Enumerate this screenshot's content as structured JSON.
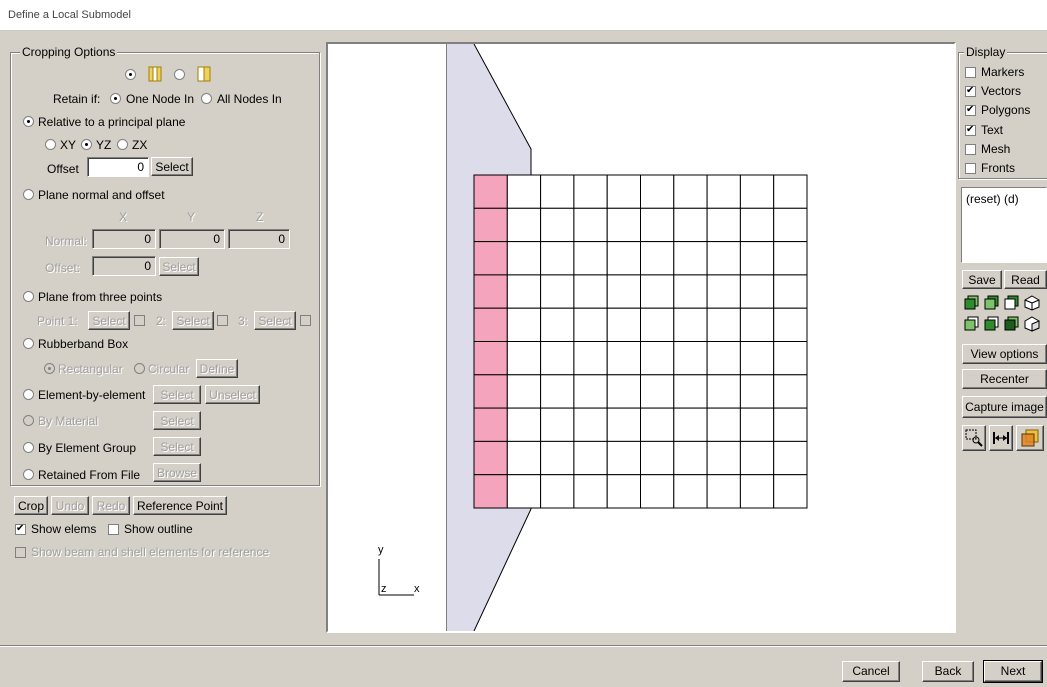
{
  "window": {
    "title": "Define a Local Submodel"
  },
  "cropping": {
    "title": "Cropping Options",
    "retain_label": "Retain if:",
    "retain_one": "One Node In",
    "retain_all": "All Nodes In",
    "relative_plane": "Relative to a principal plane",
    "plane_xy": "XY",
    "plane_yz": "YZ",
    "plane_zx": "ZX",
    "offset_label": "Offset",
    "offset_value": "0",
    "select": "Select",
    "plane_normal": "Plane normal and offset",
    "col_x": "X",
    "col_y": "Y",
    "col_z": "Z",
    "normal_label": "Normal:",
    "normal_x": "0",
    "normal_y": "0",
    "normal_z": "0",
    "offset2_label": "Offset:",
    "offset2_value": "0",
    "three_points": "Plane from three points",
    "point1": "Point 1:",
    "point2": "2:",
    "point3": "3:",
    "rubberband": "Rubberband Box",
    "rectangular": "Rectangular",
    "circular": "Circular",
    "define": "Define",
    "element_by_element": "Element-by-element",
    "unselect": "Unselect",
    "by_material": "By Material",
    "by_group": "By Element Group",
    "retained_file": "Retained From File",
    "browse": "Browse"
  },
  "toolbar": {
    "crop": "Crop",
    "undo": "Undo",
    "redo": "Redo",
    "reference_point": "Reference Point",
    "show_elems": "Show elems",
    "show_outline": "Show outline",
    "show_beam": "Show beam and shell elements for reference"
  },
  "display": {
    "title": "Display",
    "markers": "Markers",
    "vectors": "Vectors",
    "polygons": "Polygons",
    "text": "Text",
    "mesh": "Mesh",
    "fronts": "Fronts",
    "list_item": "(reset) (d)",
    "save": "Save",
    "read": "Read",
    "view_options": "View options",
    "recenter": "Recenter",
    "capture": "Capture image"
  },
  "axes": {
    "y": "y",
    "z": "z",
    "x": "x"
  },
  "footer": {
    "cancel": "Cancel",
    "back": "Back",
    "next": "Next"
  },
  "colors": {
    "highlight_column": "#f4a4bc",
    "part_fill": "#dcdcea"
  }
}
